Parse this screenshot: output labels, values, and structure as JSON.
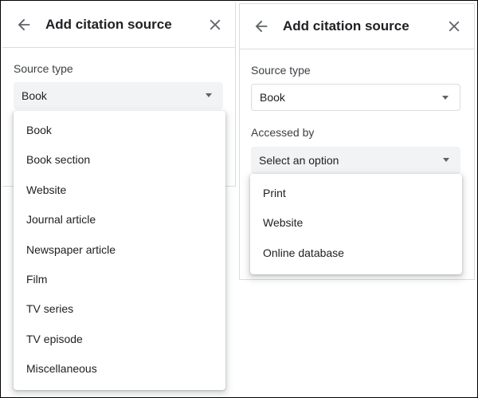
{
  "left_panel": {
    "title": "Add citation source",
    "source_type_label": "Source type",
    "source_type_value": "Book",
    "menu_items": [
      "Book",
      "Book section",
      "Website",
      "Journal article",
      "Newspaper article",
      "Film",
      "TV series",
      "TV episode",
      "Miscellaneous"
    ]
  },
  "right_panel": {
    "title": "Add citation source",
    "source_type_label": "Source type",
    "source_type_value": "Book",
    "accessed_by_label": "Accessed by",
    "accessed_by_value": "Select an option",
    "menu_items": [
      "Print",
      "Website",
      "Online database"
    ]
  },
  "icons": {
    "back": "arrow-left-icon",
    "close": "close-icon",
    "dropdown": "caret-down-icon"
  },
  "colors": {
    "text": "#202124",
    "icon": "#5f6368",
    "divider": "#dadce0",
    "filled_select": "#f1f3f4"
  }
}
